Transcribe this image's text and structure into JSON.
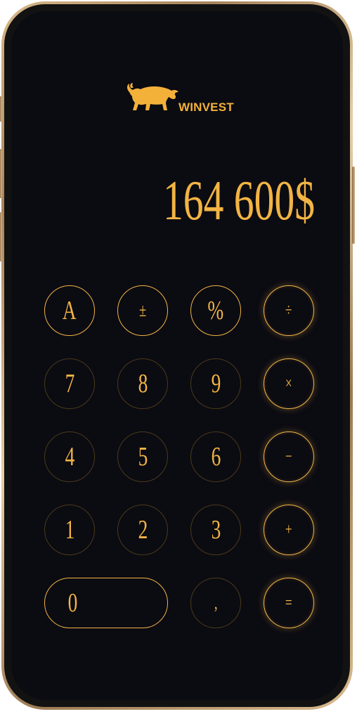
{
  "brand": {
    "name": "WINVEST",
    "logo_icon": "bull-icon",
    "accent_color": "#f2b444"
  },
  "display": {
    "value": "164 600$"
  },
  "keypad": {
    "row1": [
      "A",
      "±",
      "%",
      "÷"
    ],
    "row2": [
      "7",
      "8",
      "9",
      "×"
    ],
    "row3": [
      "4",
      "5",
      "6",
      "−"
    ],
    "row4": [
      "1",
      "2",
      "3",
      "+"
    ],
    "row5": [
      "0",
      ",",
      "="
    ]
  }
}
